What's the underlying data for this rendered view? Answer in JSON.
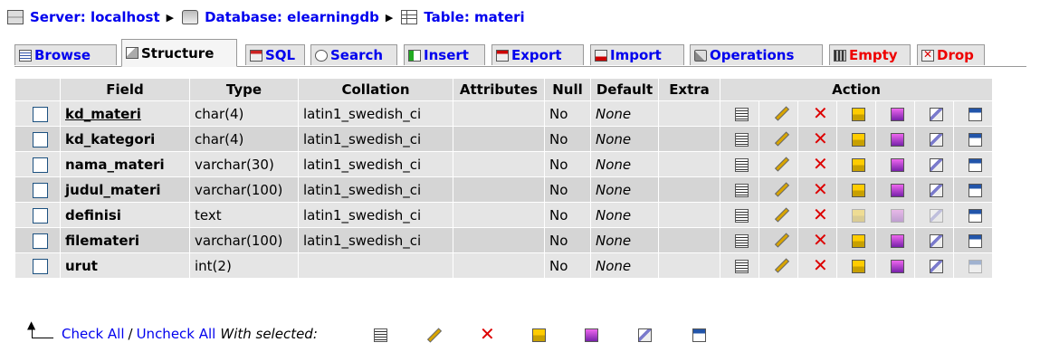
{
  "breadcrumb": {
    "server": "Server: localhost",
    "database": "Database: elearningdb",
    "table": "Table: materi"
  },
  "tabs": [
    {
      "label": "Browse",
      "icon": "browse-icon",
      "active": false
    },
    {
      "label": "Structure",
      "icon": "structure-icon",
      "active": true
    },
    {
      "label": "SQL",
      "icon": "sql-icon",
      "active": false
    },
    {
      "label": "Search",
      "icon": "search-icon",
      "active": false
    },
    {
      "label": "Insert",
      "icon": "insert-icon",
      "active": false
    },
    {
      "label": "Export",
      "icon": "export-icon",
      "active": false
    },
    {
      "label": "Import",
      "icon": "import-icon",
      "active": false
    },
    {
      "label": "Operations",
      "icon": "operations-icon",
      "active": false
    },
    {
      "label": "Empty",
      "icon": "empty-icon",
      "active": false
    },
    {
      "label": "Drop",
      "icon": "drop-icon",
      "active": false
    }
  ],
  "table": {
    "headers": {
      "field": "Field",
      "type": "Type",
      "collation": "Collation",
      "attributes": "Attributes",
      "null": "Null",
      "default": "Default",
      "extra": "Extra",
      "action": "Action"
    },
    "rows": [
      {
        "field": "kd_materi",
        "type": "char(4)",
        "collation": "latin1_swedish_ci",
        "attributes": "",
        "null": "No",
        "default": "None",
        "extra": "",
        "primary_key": true
      },
      {
        "field": "kd_kategori",
        "type": "char(4)",
        "collation": "latin1_swedish_ci",
        "attributes": "",
        "null": "No",
        "default": "None",
        "extra": ""
      },
      {
        "field": "nama_materi",
        "type": "varchar(30)",
        "collation": "latin1_swedish_ci",
        "attributes": "",
        "null": "No",
        "default": "None",
        "extra": ""
      },
      {
        "field": "judul_materi",
        "type": "varchar(100)",
        "collation": "latin1_swedish_ci",
        "attributes": "",
        "null": "No",
        "default": "None",
        "extra": ""
      },
      {
        "field": "definisi",
        "type": "text",
        "collation": "latin1_swedish_ci",
        "attributes": "",
        "null": "No",
        "default": "None",
        "extra": ""
      },
      {
        "field": "filemateri",
        "type": "varchar(100)",
        "collation": "latin1_swedish_ci",
        "attributes": "",
        "null": "No",
        "default": "None",
        "extra": ""
      },
      {
        "field": "urut",
        "type": "int(2)",
        "collation": "",
        "attributes": "",
        "null": "No",
        "default": "None",
        "extra": ""
      }
    ],
    "actions": [
      "browse-distinct-icon",
      "change-icon",
      "drop-icon",
      "primary-icon",
      "unique-icon",
      "index-icon",
      "fulltext-icon"
    ]
  },
  "footer": {
    "check_all": "Check All",
    "separator": "/",
    "uncheck_all": "Uncheck All",
    "with_selected": "With selected:"
  }
}
